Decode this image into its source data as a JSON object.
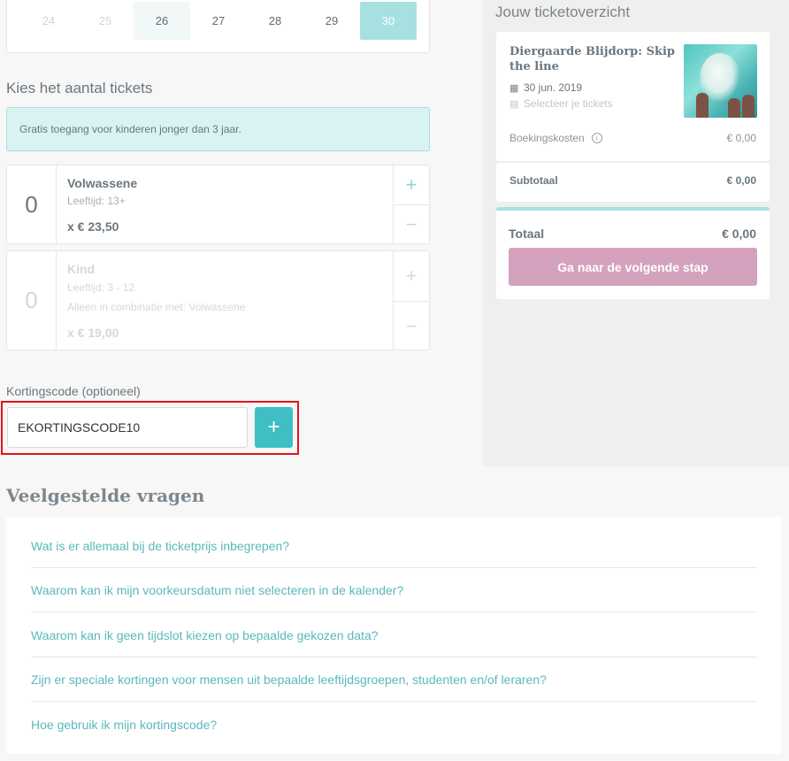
{
  "calendar": {
    "days": [
      {
        "label": "24",
        "state": "disabled"
      },
      {
        "label": "25",
        "state": "disabled"
      },
      {
        "label": "26",
        "state": "available"
      },
      {
        "label": "27",
        "state": "normal"
      },
      {
        "label": "28",
        "state": "normal"
      },
      {
        "label": "29",
        "state": "normal"
      },
      {
        "label": "30",
        "state": "selected"
      }
    ]
  },
  "tickets": {
    "title": "Kies het aantal tickets",
    "info": "Gratis toegang voor kinderen jonger dan 3 jaar.",
    "items": [
      {
        "quantity": "0",
        "name": "Volwassene",
        "age": "Leeftijd: 13+",
        "note": "",
        "price": "x € 23,50",
        "plus": "+",
        "minus": "−"
      },
      {
        "quantity": "0",
        "name": "Kind",
        "age": "Leeftijd: 3 - 12",
        "note": "Alleen in combinatie met: Volwassene",
        "price": "x € 19,00",
        "plus": "+",
        "minus": "−"
      }
    ]
  },
  "coupon": {
    "label": "Kortingscode (optioneel)",
    "value": "EKORTINGSCODE10",
    "add_label": "+"
  },
  "overview": {
    "title": "Jouw ticketoverzicht",
    "attraction": "Diergaarde Blijdorp: Skip the line",
    "date": "30 jun. 2019",
    "select_prompt": "Selecteer je tickets",
    "fee_label": "Boekingskosten",
    "fee_value": "€ 0,00",
    "subtotal_label": "Subtotaal",
    "subtotal_value": "€ 0,00",
    "total_label": "Totaal",
    "total_value": "€ 0,00",
    "next_button": "Ga naar de volgende stap"
  },
  "faq": {
    "title": "Veelgestelde vragen",
    "items": [
      "Wat is er allemaal bij de ticketprijs inbegrepen?",
      "Waarom kan ik mijn voorkeursdatum niet selecteren in de kalender?",
      "Waarom kan ik geen tijdslot kiezen op bepaalde gekozen data?",
      "Zijn er speciale kortingen voor mensen uit bepaalde leeftijdsgroepen, studenten en/of leraren?",
      "Hoe gebruik ik mijn kortingscode?"
    ]
  },
  "colors": {
    "accent": "#3fbfc4",
    "selected_day": "#a8e0e2",
    "next_button": "#d4a2bf",
    "highlight": "#e3141b"
  }
}
